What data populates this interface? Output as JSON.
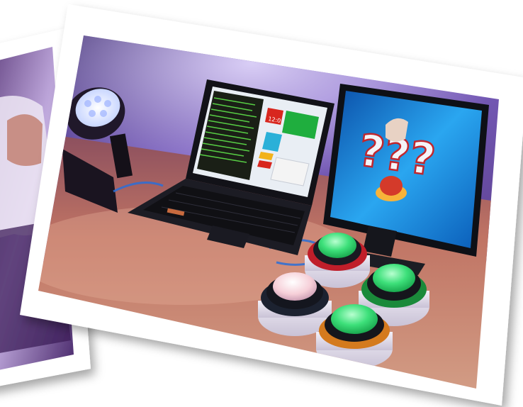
{
  "scene": {
    "alt": "Two tilted photo prints: a quiz buzzer setup with a laptop, a monitor showing question marks, a stage light and four lit buzzer buttons",
    "colors": {
      "background": "#ffffff",
      "photo_border": "#ffffff",
      "wall_purple": "#6a4fa8",
      "table_wood": "#b86a60",
      "buzzer_green": "#3de07a",
      "buzzer_pink": "#f6cfd8",
      "monitor_blue": "#1e8fe0"
    },
    "laptop_screen": {
      "counter_text": "12:0"
    },
    "monitor": {
      "marks": "???"
    },
    "buzzers": [
      {
        "ring": "#c01e2a",
        "dome": "#3de07a"
      },
      {
        "ring": "#1c2230",
        "dome": "#f6cfd8"
      },
      {
        "ring": "#1a8a3a",
        "dome": "#3de07a"
      },
      {
        "ring": "#d47a1e",
        "dome": "#3de07a"
      }
    ]
  }
}
